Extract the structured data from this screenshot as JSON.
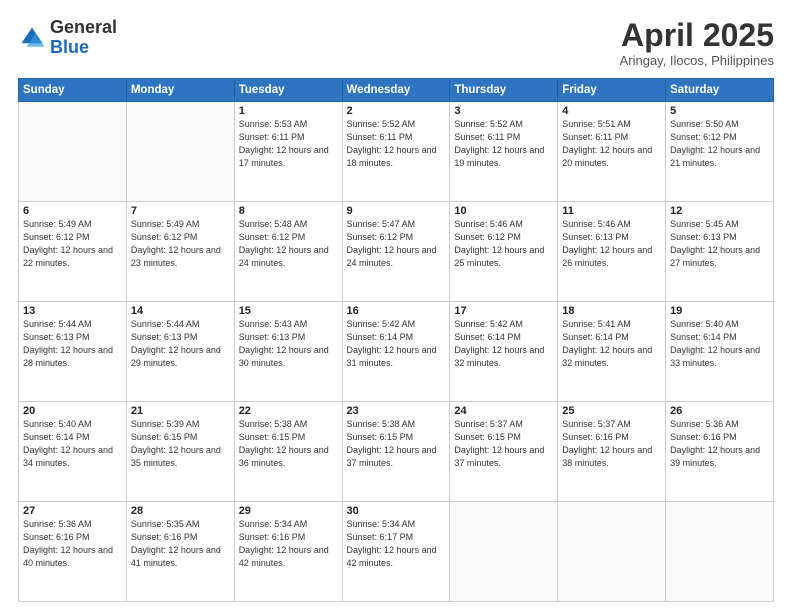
{
  "header": {
    "logo_general": "General",
    "logo_blue": "Blue",
    "month_title": "April 2025",
    "subtitle": "Aringay, Ilocos, Philippines"
  },
  "days_of_week": [
    "Sunday",
    "Monday",
    "Tuesday",
    "Wednesday",
    "Thursday",
    "Friday",
    "Saturday"
  ],
  "weeks": [
    [
      {
        "day": "",
        "info": ""
      },
      {
        "day": "",
        "info": ""
      },
      {
        "day": "1",
        "info": "Sunrise: 5:53 AM\nSunset: 6:11 PM\nDaylight: 12 hours and 17 minutes."
      },
      {
        "day": "2",
        "info": "Sunrise: 5:52 AM\nSunset: 6:11 PM\nDaylight: 12 hours and 18 minutes."
      },
      {
        "day": "3",
        "info": "Sunrise: 5:52 AM\nSunset: 6:11 PM\nDaylight: 12 hours and 19 minutes."
      },
      {
        "day": "4",
        "info": "Sunrise: 5:51 AM\nSunset: 6:11 PM\nDaylight: 12 hours and 20 minutes."
      },
      {
        "day": "5",
        "info": "Sunrise: 5:50 AM\nSunset: 6:12 PM\nDaylight: 12 hours and 21 minutes."
      }
    ],
    [
      {
        "day": "6",
        "info": "Sunrise: 5:49 AM\nSunset: 6:12 PM\nDaylight: 12 hours and 22 minutes."
      },
      {
        "day": "7",
        "info": "Sunrise: 5:49 AM\nSunset: 6:12 PM\nDaylight: 12 hours and 23 minutes."
      },
      {
        "day": "8",
        "info": "Sunrise: 5:48 AM\nSunset: 6:12 PM\nDaylight: 12 hours and 24 minutes."
      },
      {
        "day": "9",
        "info": "Sunrise: 5:47 AM\nSunset: 6:12 PM\nDaylight: 12 hours and 24 minutes."
      },
      {
        "day": "10",
        "info": "Sunrise: 5:46 AM\nSunset: 6:12 PM\nDaylight: 12 hours and 25 minutes."
      },
      {
        "day": "11",
        "info": "Sunrise: 5:46 AM\nSunset: 6:13 PM\nDaylight: 12 hours and 26 minutes."
      },
      {
        "day": "12",
        "info": "Sunrise: 5:45 AM\nSunset: 6:13 PM\nDaylight: 12 hours and 27 minutes."
      }
    ],
    [
      {
        "day": "13",
        "info": "Sunrise: 5:44 AM\nSunset: 6:13 PM\nDaylight: 12 hours and 28 minutes."
      },
      {
        "day": "14",
        "info": "Sunrise: 5:44 AM\nSunset: 6:13 PM\nDaylight: 12 hours and 29 minutes."
      },
      {
        "day": "15",
        "info": "Sunrise: 5:43 AM\nSunset: 6:13 PM\nDaylight: 12 hours and 30 minutes."
      },
      {
        "day": "16",
        "info": "Sunrise: 5:42 AM\nSunset: 6:14 PM\nDaylight: 12 hours and 31 minutes."
      },
      {
        "day": "17",
        "info": "Sunrise: 5:42 AM\nSunset: 6:14 PM\nDaylight: 12 hours and 32 minutes."
      },
      {
        "day": "18",
        "info": "Sunrise: 5:41 AM\nSunset: 6:14 PM\nDaylight: 12 hours and 32 minutes."
      },
      {
        "day": "19",
        "info": "Sunrise: 5:40 AM\nSunset: 6:14 PM\nDaylight: 12 hours and 33 minutes."
      }
    ],
    [
      {
        "day": "20",
        "info": "Sunrise: 5:40 AM\nSunset: 6:14 PM\nDaylight: 12 hours and 34 minutes."
      },
      {
        "day": "21",
        "info": "Sunrise: 5:39 AM\nSunset: 6:15 PM\nDaylight: 12 hours and 35 minutes."
      },
      {
        "day": "22",
        "info": "Sunrise: 5:38 AM\nSunset: 6:15 PM\nDaylight: 12 hours and 36 minutes."
      },
      {
        "day": "23",
        "info": "Sunrise: 5:38 AM\nSunset: 6:15 PM\nDaylight: 12 hours and 37 minutes."
      },
      {
        "day": "24",
        "info": "Sunrise: 5:37 AM\nSunset: 6:15 PM\nDaylight: 12 hours and 37 minutes."
      },
      {
        "day": "25",
        "info": "Sunrise: 5:37 AM\nSunset: 6:16 PM\nDaylight: 12 hours and 38 minutes."
      },
      {
        "day": "26",
        "info": "Sunrise: 5:36 AM\nSunset: 6:16 PM\nDaylight: 12 hours and 39 minutes."
      }
    ],
    [
      {
        "day": "27",
        "info": "Sunrise: 5:36 AM\nSunset: 6:16 PM\nDaylight: 12 hours and 40 minutes."
      },
      {
        "day": "28",
        "info": "Sunrise: 5:35 AM\nSunset: 6:16 PM\nDaylight: 12 hours and 41 minutes."
      },
      {
        "day": "29",
        "info": "Sunrise: 5:34 AM\nSunset: 6:16 PM\nDaylight: 12 hours and 42 minutes."
      },
      {
        "day": "30",
        "info": "Sunrise: 5:34 AM\nSunset: 6:17 PM\nDaylight: 12 hours and 42 minutes."
      },
      {
        "day": "",
        "info": ""
      },
      {
        "day": "",
        "info": ""
      },
      {
        "day": "",
        "info": ""
      }
    ]
  ]
}
